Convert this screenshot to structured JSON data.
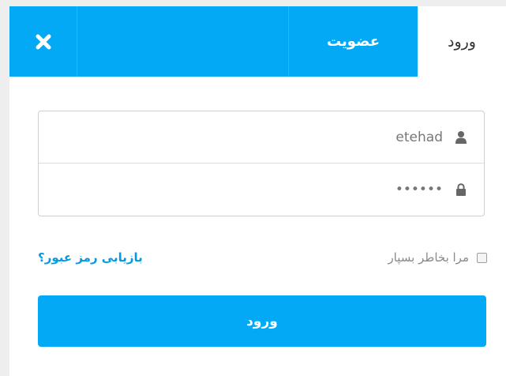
{
  "tabs": {
    "login_label": "ورود",
    "register_label": "عضویت",
    "close_icon": "close-icon"
  },
  "form": {
    "username": {
      "value": "etehad",
      "icon": "user-icon"
    },
    "password": {
      "value": "••••••",
      "icon": "lock-icon"
    },
    "remember_label": "مرا بخاطر بسپار",
    "remember_checked": false,
    "forgot_label": "بازیابی رمز عبور؟",
    "submit_label": "ورود"
  },
  "colors": {
    "accent": "#03a9f4",
    "link": "#039be5",
    "page_background": "#eeeeee"
  }
}
